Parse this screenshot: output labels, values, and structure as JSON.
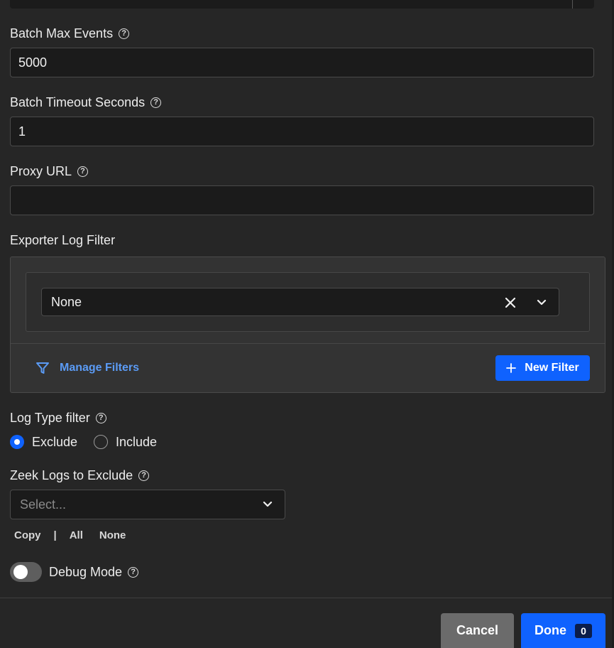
{
  "fields": {
    "batch_max_events": {
      "label": "Batch Max Events",
      "value": "5000"
    },
    "batch_timeout_seconds": {
      "label": "Batch Timeout Seconds",
      "value": "1"
    },
    "proxy_url": {
      "label": "Proxy URL",
      "value": ""
    }
  },
  "exporter_log_filter": {
    "label": "Exporter Log Filter",
    "selected": "None",
    "manage_filters_label": "Manage Filters",
    "new_filter_label": "New Filter"
  },
  "log_type_filter": {
    "label": "Log Type filter",
    "options": [
      "Exclude",
      "Include"
    ],
    "selected": "Exclude"
  },
  "zeek_logs": {
    "label": "Zeek Logs to Exclude",
    "placeholder": "Select...",
    "actions": {
      "copy": "Copy",
      "separator": "|",
      "all": "All",
      "none": "None"
    }
  },
  "debug_mode": {
    "label": "Debug Mode",
    "enabled": false
  },
  "footer": {
    "cancel_label": "Cancel",
    "done_label": "Done",
    "done_count": "0"
  },
  "colors": {
    "primary": "#0f62fe",
    "link": "#5b9bf5",
    "background": "#262626"
  },
  "icons": {
    "help": "question-circle-icon",
    "filter": "filter-funnel-icon",
    "plus": "plus-icon",
    "clear": "close-icon",
    "chevron": "chevron-down-icon"
  }
}
